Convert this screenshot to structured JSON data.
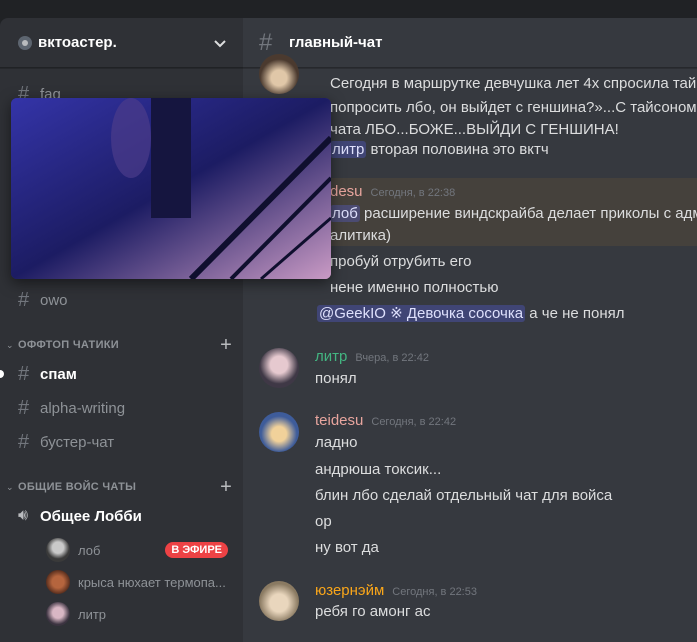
{
  "server": {
    "name": "вктоастер."
  },
  "sidebar": {
    "channels_top": [
      {
        "label": "faq"
      },
      {
        "label": "owo"
      }
    ],
    "categories": {
      "offtop": "ОФФТОП ЧАТИКИ",
      "voice": "ОБЩИЕ ВОЙС ЧАТЫ"
    },
    "offtop_channels": [
      {
        "label": "спам"
      },
      {
        "label": "alpha-writing"
      },
      {
        "label": "бустер-чат"
      }
    ],
    "voice_channel": {
      "label": "Общее Лобби"
    },
    "voice_users": [
      {
        "name": "лоб",
        "badge": "В ЭФИРЕ"
      },
      {
        "name": "крыса нюхает термопа..."
      },
      {
        "name": "литр"
      }
    ]
  },
  "main": {
    "channel_title": "главный-чат",
    "messages_top": {
      "line1": "Сегодня в маршрутке девчушка лет 4х спросила тай",
      "line2": "попросить лбо, он выйдет с геншина?»...С тайсоном",
      "line3": "чата ЛБО...БОЖЕ...ВЫЙДИ С ГЕНШИНА!",
      "line4_mention": "литр",
      "line4_text": " вторая половина это вктч"
    },
    "teidesu_block": {
      "author": "desu",
      "ts": "Сегодня, в 22:38",
      "mention": "лоб",
      "line1": " расширение виндскрайба делает приколы с адм",
      "line2": "алитика)",
      "line3": "пробуй отрубить его",
      "line4": "нене именно полностью",
      "line5_mention": "@GeekIO ※ Девочка сосочка",
      "line5_text": " а че не понял"
    },
    "litr_msg": {
      "author": "литр",
      "ts": "Вчера, в 22:42",
      "line1": "понял"
    },
    "teidesu_msg": {
      "author": "teidesu",
      "ts": "Сегодня, в 22:42",
      "lines": [
        "ладно",
        "андрюша токсик...",
        "блин лбо сделай отдельный чат для войса",
        "ор",
        "ну вот да"
      ]
    },
    "username_msg": {
      "author": "юзернэйм",
      "ts": "Сегодня, в 22:53",
      "line1": "ребя го амонг ас"
    }
  },
  "colors": {
    "litr": "#43b581",
    "teidesu": "#e8a59e",
    "username": "#faa61a",
    "live": "#ed4245"
  }
}
